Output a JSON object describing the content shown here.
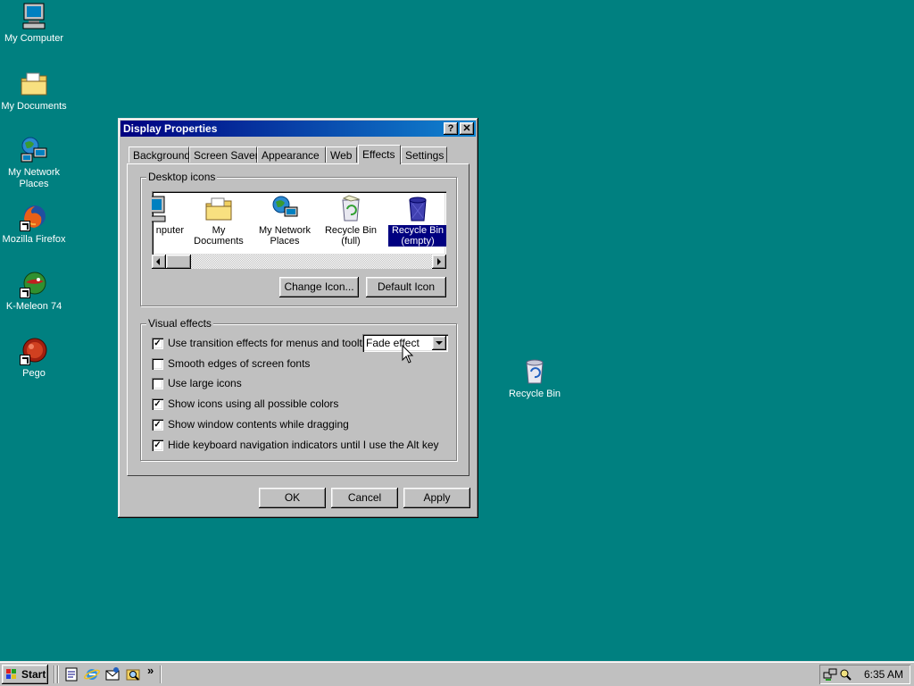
{
  "desktop": {
    "icons": [
      {
        "label": "My Computer",
        "icon": "computer-icon"
      },
      {
        "label": "My Documents",
        "icon": "folder-documents-icon"
      },
      {
        "label": "My Network Places",
        "icon": "network-places-icon"
      },
      {
        "label": "Mozilla Firefox",
        "icon": "firefox-icon"
      },
      {
        "label": "K-Meleon 74",
        "icon": "kmeleon-icon"
      },
      {
        "label": "Pego",
        "icon": "pego-icon"
      },
      {
        "label": "Recycle Bin",
        "icon": "recycle-bin-icon"
      }
    ]
  },
  "window": {
    "title": "Display Properties",
    "help_glyph": "?",
    "close_glyph": "✕",
    "tabs": [
      "Background",
      "Screen Saver",
      "Appearance",
      "Web",
      "Effects",
      "Settings"
    ],
    "active_tab": "Effects",
    "desktop_icons": {
      "legend": "Desktop icons",
      "items": [
        {
          "label": "nputer",
          "icon": "computer-icon"
        },
        {
          "label": "My Documents",
          "icon": "folder-documents-icon"
        },
        {
          "label": "My Network Places",
          "icon": "network-places-icon"
        },
        {
          "label": "Recycle Bin (full)",
          "icon": "recycle-bin-full-icon"
        },
        {
          "label": "Recycle Bin (empty)",
          "icon": "recycle-bin-empty-icon",
          "selected": true
        }
      ],
      "change_icon": "Change Icon...",
      "default_icon": "Default Icon"
    },
    "visual_effects": {
      "legend": "Visual effects",
      "options": [
        {
          "label": "Use transition effects for menus and tooltips",
          "checked": true
        },
        {
          "label": "Smooth edges of screen fonts",
          "checked": false
        },
        {
          "label": "Use large icons",
          "checked": false
        },
        {
          "label": "Show icons using all possible colors",
          "checked": true
        },
        {
          "label": "Show window contents while dragging",
          "checked": true
        },
        {
          "label": "Hide keyboard navigation indicators until I use the Alt key",
          "checked": true
        }
      ],
      "transition_select": "Fade effect"
    },
    "buttons": {
      "ok": "OK",
      "cancel": "Cancel",
      "apply": "Apply"
    }
  },
  "taskbar": {
    "start": "Start",
    "more": "»",
    "clock": "6:35 AM"
  },
  "colors": {
    "desktop": "#008080",
    "titlebar": "#000080",
    "face": "#c0c0c0"
  }
}
